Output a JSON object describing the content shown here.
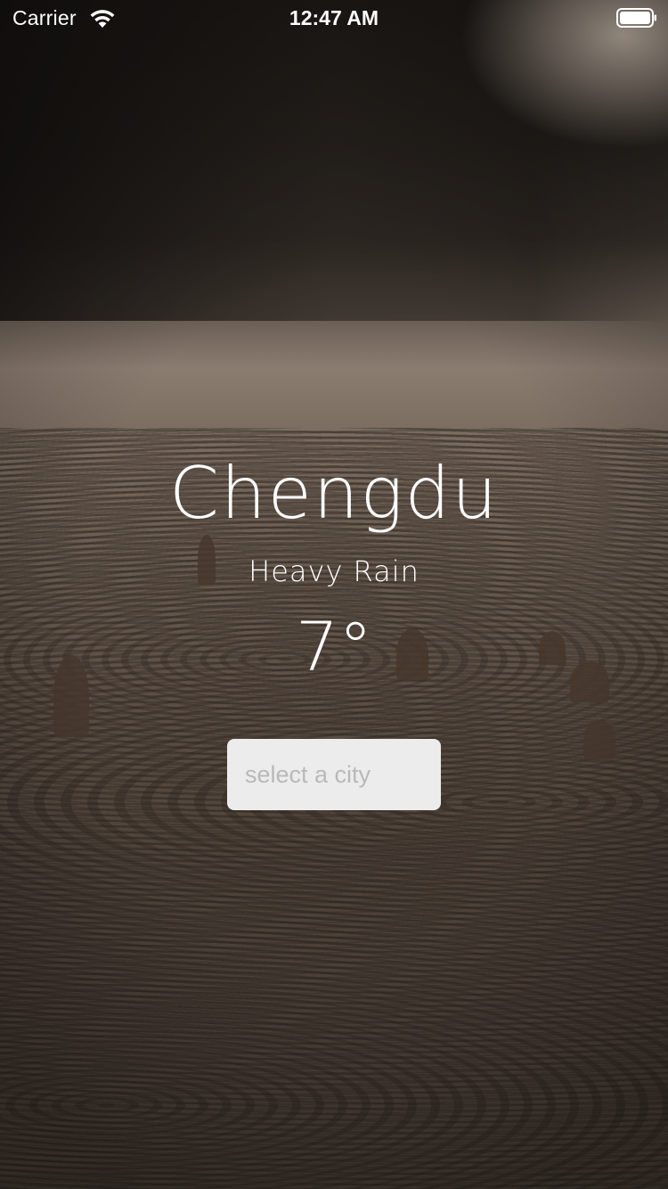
{
  "status_bar": {
    "carrier": "Carrier",
    "time": "12:47 AM",
    "wifi_icon": "wifi-icon",
    "battery_icon": "battery-icon"
  },
  "weather": {
    "city": "Chengdu",
    "condition": "Heavy Rain",
    "temperature": "7°"
  },
  "search": {
    "placeholder": "select a city",
    "value": ""
  },
  "colors": {
    "text": "#ffffff",
    "input_background": "#ececec",
    "placeholder": "#b9b9b9"
  }
}
